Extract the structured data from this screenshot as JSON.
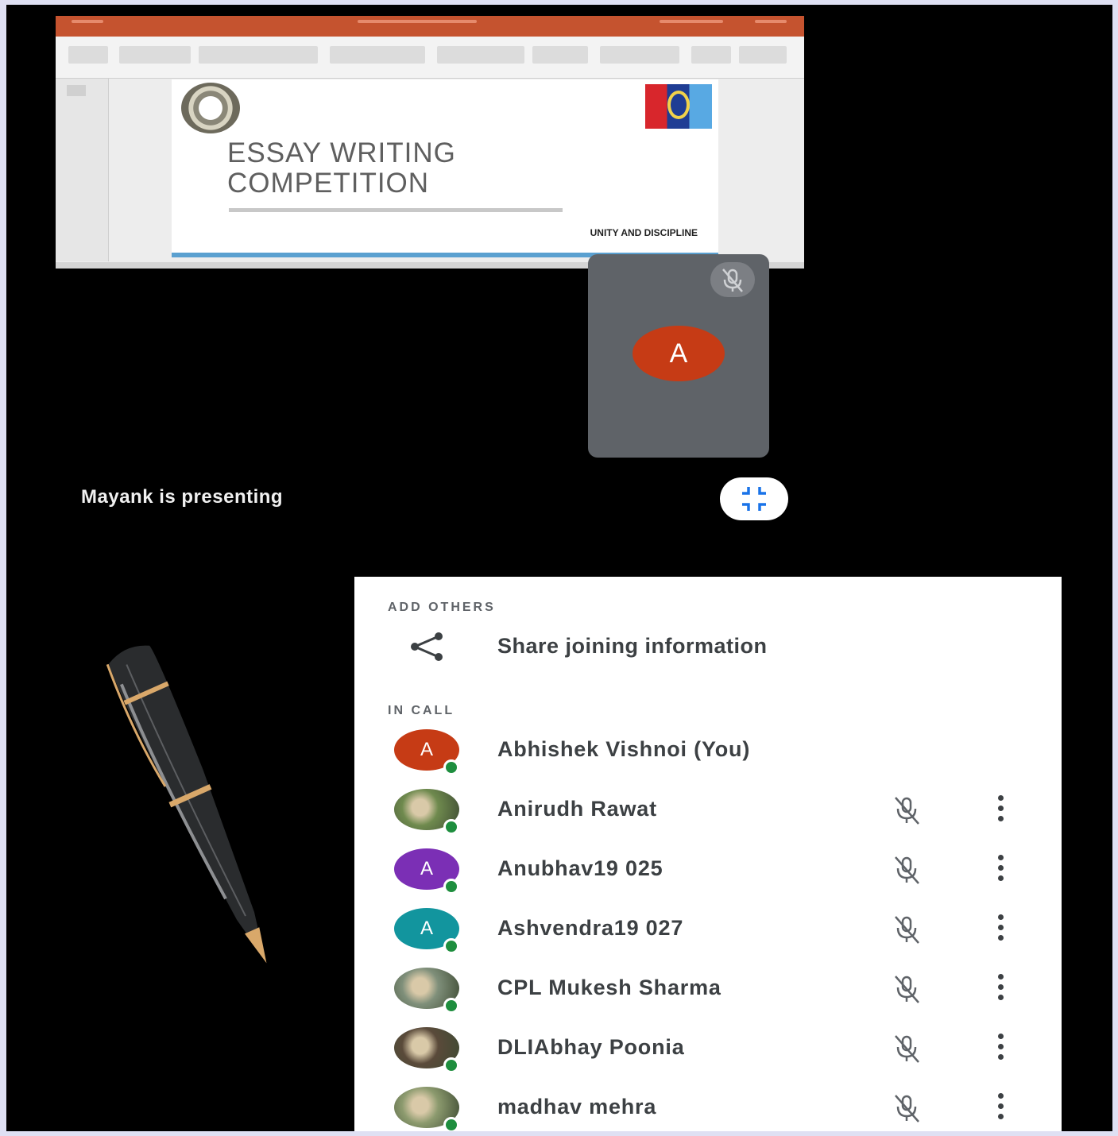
{
  "presentation": {
    "slide_title_line1": "ESSAY WRITING",
    "slide_title_line2": "COMPETITION",
    "slide_tagline": "UNITY AND DISCIPLINE"
  },
  "self_tile": {
    "avatar_letter": "A",
    "avatar_color": "#c63b15",
    "mic_icon": "mic-off-icon"
  },
  "presenter_status": "Mayank is presenting",
  "fullscreen_icon": "exit-fullscreen-icon",
  "panel": {
    "add_others_label": "ADD OTHERS",
    "share_label": "Share joining information",
    "share_icon": "share-icon",
    "in_call_label": "IN CALL",
    "participants": [
      {
        "name": "Abhishek Vishnoi (You)",
        "avatar_letter": "A",
        "avatar_color": "#c63b15",
        "avatar_type": "letter",
        "muted_icon": false
      },
      {
        "name": "Anirudh Rawat",
        "avatar_letter": "",
        "avatar_color": "#6f8a4e",
        "avatar_type": "photo",
        "muted_icon": true
      },
      {
        "name": "Anubhav19 025",
        "avatar_letter": "A",
        "avatar_color": "#7b2fb5",
        "avatar_type": "letter",
        "muted_icon": true
      },
      {
        "name": "Ashvendra19 027",
        "avatar_letter": "A",
        "avatar_color": "#12959e",
        "avatar_type": "letter",
        "muted_icon": true
      },
      {
        "name": "CPL Mukesh Sharma",
        "avatar_letter": "",
        "avatar_color": "#7f8f7a",
        "avatar_type": "photo",
        "muted_icon": true
      },
      {
        "name": "DLIAbhay Poonia",
        "avatar_letter": "",
        "avatar_color": "#5a4a3a",
        "avatar_type": "photo",
        "muted_icon": true
      },
      {
        "name": "madhav mehra",
        "avatar_letter": "",
        "avatar_color": "#8c9a6e",
        "avatar_type": "photo",
        "muted_icon": true
      }
    ]
  }
}
